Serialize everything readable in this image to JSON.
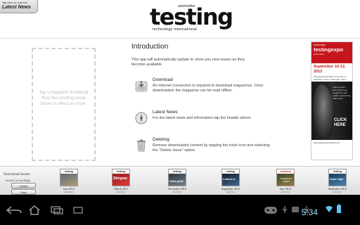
{
  "header": {
    "latest_small": "Tap here to read the",
    "latest_big": "Latest News",
    "logo": {
      "top": "automotive",
      "main": "testing",
      "sub": "technology international"
    }
  },
  "placeholder": {
    "text": "Tap a magazine thumbnail from the scrolling panel below to select an issue."
  },
  "intro": {
    "title": "Introduction",
    "text": "This app will automatically update to show you new issues as they become available",
    "items": [
      {
        "icon": "download-icon",
        "title": "Download",
        "text": "An internet connection is required to download magazines. Once downloaded, the magazine can be read offline."
      },
      {
        "icon": "compass-icon",
        "title": "Latest News",
        "text": "For the latest news and information tap the header above."
      },
      {
        "icon": "trash-icon",
        "title": "Deleting",
        "text": "Remove downloaded content by tapping the trash icon and selecting the \"Delete Issue\" option."
      }
    ]
  },
  "ad": {
    "logo_small": "automotive",
    "logo_big": "testingexpo",
    "logo_sub": "2013 china",
    "date": "September 10-12, 2013",
    "place": "Shanghai Everbright Convention & Exhibition Center, Shanghai, China",
    "desc": "China's ONLY automotive test, evaluation, and quality engineering trade show",
    "click": "CLICK HERE",
    "url": "www.testing-expochina.com",
    "accent": "#c4151c"
  },
  "shelf": {
    "title": "Download Issues",
    "subtitle": "Scrolls Left and Right",
    "library": "Library",
    "help": "Help",
    "magazines": [
      {
        "date": "June 2013",
        "action": "Read Now",
        "head": "testing",
        "cover_text": "",
        "colors": [
          "#5a6b7a",
          "#b8a070"
        ]
      },
      {
        "date": "March 2013",
        "action": "Read Now",
        "head": "testing",
        "cover_text": "Stingray",
        "colors": [
          "#9b1c1c",
          "#e03c3c"
        ]
      },
      {
        "date": "November 2012",
        "action": "Read Now",
        "head": "testing",
        "cover_text": "Cable guide",
        "colors": [
          "#2b3540",
          "#7d8c99"
        ]
      },
      {
        "date": "September 2012",
        "action": "Read Now",
        "head": "testing",
        "cover_text": "Linked in",
        "colors": [
          "#1a1f2a",
          "#3d6f99"
        ]
      },
      {
        "date": "June 2012",
        "action": "Read Now",
        "head": "crashtest",
        "cover_text": "Pedestrian Impact",
        "colors": [
          "#3a4a2a",
          "#a08040"
        ]
      },
      {
        "date": "September 2012",
        "action": "Read Now",
        "head": "testing",
        "cover_text": "Super Light",
        "colors": [
          "#1a3a5a",
          "#4a8abf"
        ]
      }
    ]
  },
  "status_bar": {
    "time": "5:34",
    "time_color": "#9adfff"
  }
}
